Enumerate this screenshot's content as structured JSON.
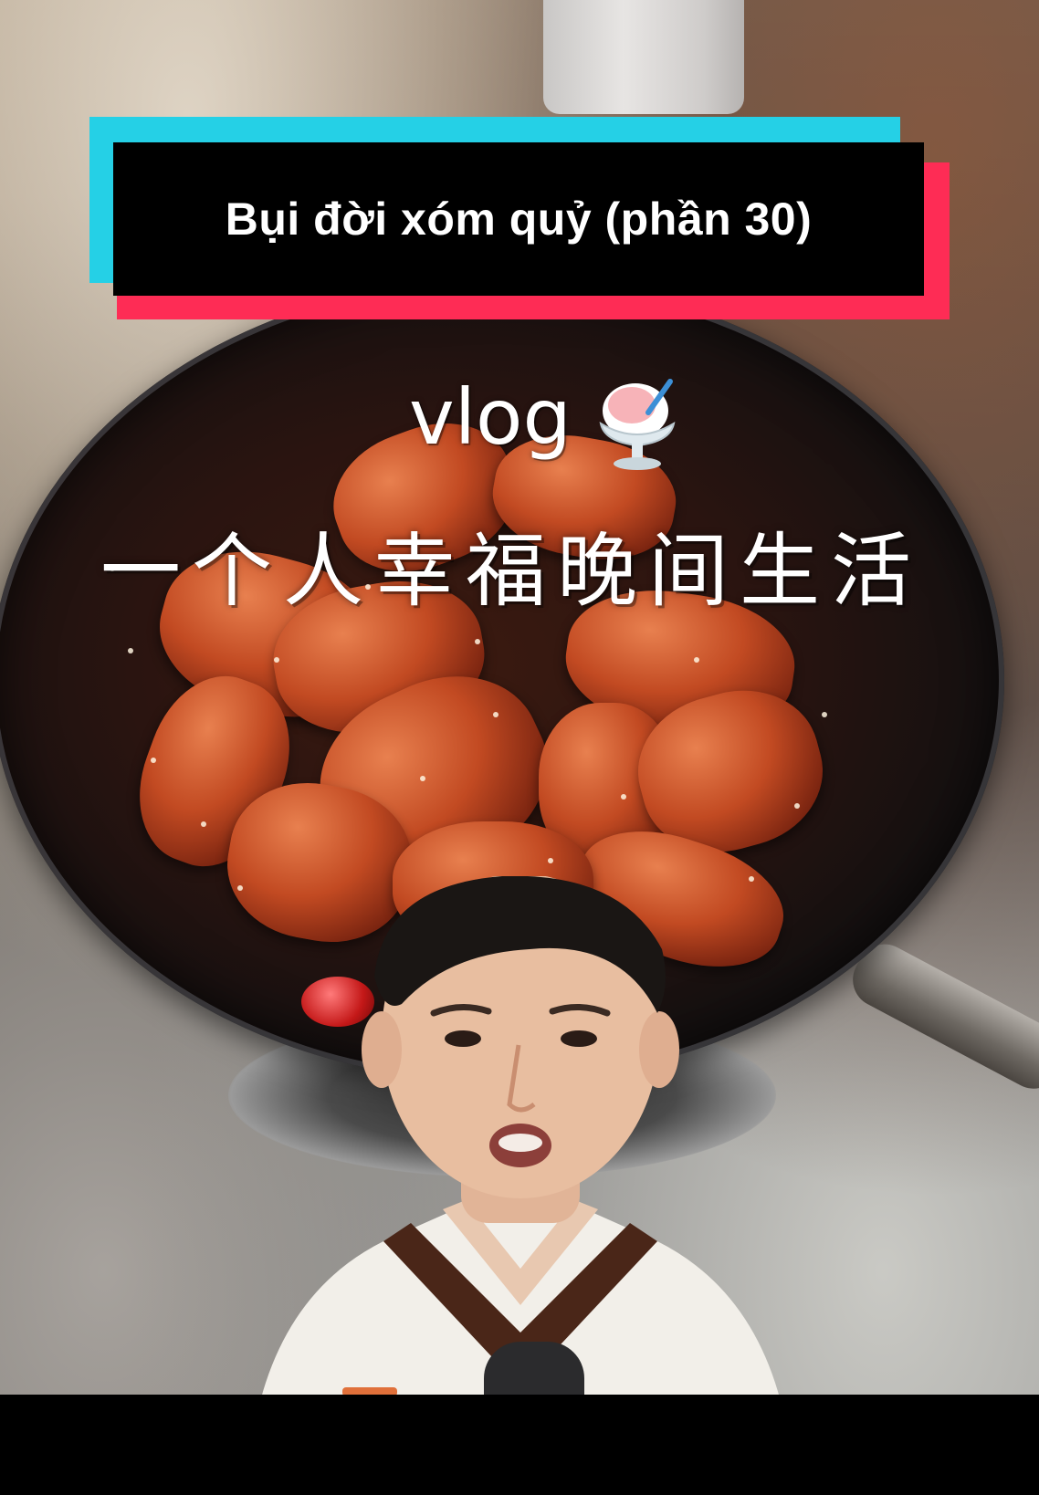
{
  "overlay": {
    "title": "Bụi đời xóm quỷ (phần 30)",
    "vlog_label": "vlog",
    "caption": "一个人幸福晚间生活"
  },
  "colors": {
    "title_box_bg": "#000000",
    "title_cyan_accent": "#25d0e6",
    "title_red_accent": "#fe2c55",
    "title_text": "#ffffff",
    "caption_text": "#ffffff"
  },
  "icons": {
    "vlog_emoji": "shaved-ice-icon"
  }
}
